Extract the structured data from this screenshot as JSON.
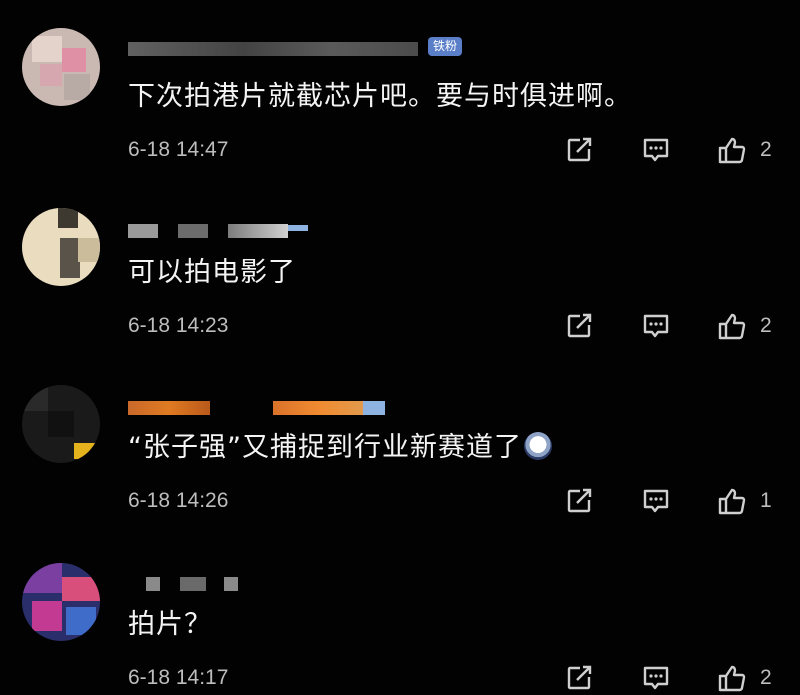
{
  "comments": [
    {
      "badge": "铁粉",
      "text": "下次拍港片就截芯片吧。要与时俱进啊。",
      "time": "6-18 14:47",
      "likes": "2"
    },
    {
      "text": "可以拍电影了",
      "time": "6-18 14:23",
      "likes": "2"
    },
    {
      "text": "“张子强”又捕捉到行业新赛道了",
      "time": "6-18 14:26",
      "likes": "1"
    },
    {
      "text": "拍片？",
      "time": "6-18 14:17",
      "likes": "2"
    }
  ],
  "icons": {
    "share": "share-icon",
    "reply": "comment-icon",
    "like": "thumbs-up-icon"
  },
  "colors": {
    "background": "#020202",
    "text": "#f4f4f4",
    "meta": "#bdbdbd",
    "badge": "#5a7ec8"
  }
}
